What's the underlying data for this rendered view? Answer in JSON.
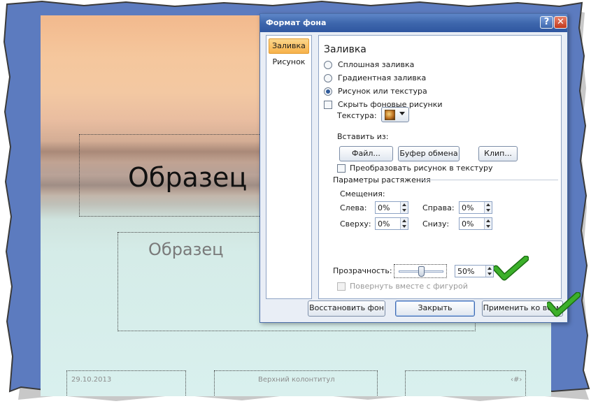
{
  "slide": {
    "title": "Образец",
    "subtitle": "Образец",
    "footer_date": "29.10.2013",
    "footer_center": "Верхний колонтитул",
    "footer_page": "‹#›"
  },
  "dialog": {
    "title": "Формат фона",
    "help_label": "?",
    "close_label": "✕",
    "nav": {
      "fill": "Заливка",
      "picture": "Рисунок"
    },
    "section_title": "Заливка",
    "fill_options": [
      {
        "label": "Сплошная заливка",
        "checked": false
      },
      {
        "label": "Градиентная заливка",
        "checked": false
      },
      {
        "label": "Рисунок или текстура",
        "checked": true
      }
    ],
    "hide_background": {
      "label": "Скрыть фоновые рисунки",
      "checked": false
    },
    "texture_label": "Текстура:",
    "insert_from_label": "Вставить из:",
    "buttons": {
      "file": "Файл...",
      "clipboard": "Буфер обмена",
      "clip": "Клип..."
    },
    "tile_texture": {
      "label": "Преобразовать рисунок в текстуру",
      "checked": false
    },
    "stretch_params_label": "Параметры растяжения",
    "offsets_label": "Смещения:",
    "offsets": {
      "left_label": "Слева:",
      "left_value": "0%",
      "right_label": "Справа:",
      "right_value": "0%",
      "top_label": "Сверху:",
      "top_value": "0%",
      "bottom_label": "Снизу:",
      "bottom_value": "0%"
    },
    "transparency_label": "Прозрачность:",
    "transparency_value": "50%",
    "transparency_level": 0.5,
    "rotate_with_shape": {
      "label": "Повернуть вместе с фигурой",
      "checked": false,
      "disabled": true
    },
    "footer": {
      "reset": "Восстановить фон",
      "close": "Закрыть",
      "apply_all": "Применить ко всем"
    }
  },
  "colors": {
    "titlebar": "#3e67ad",
    "accent_nav": "#f7b24a",
    "check_mark": "#2e9a1e",
    "frame_blue": "#5c7bbf"
  }
}
